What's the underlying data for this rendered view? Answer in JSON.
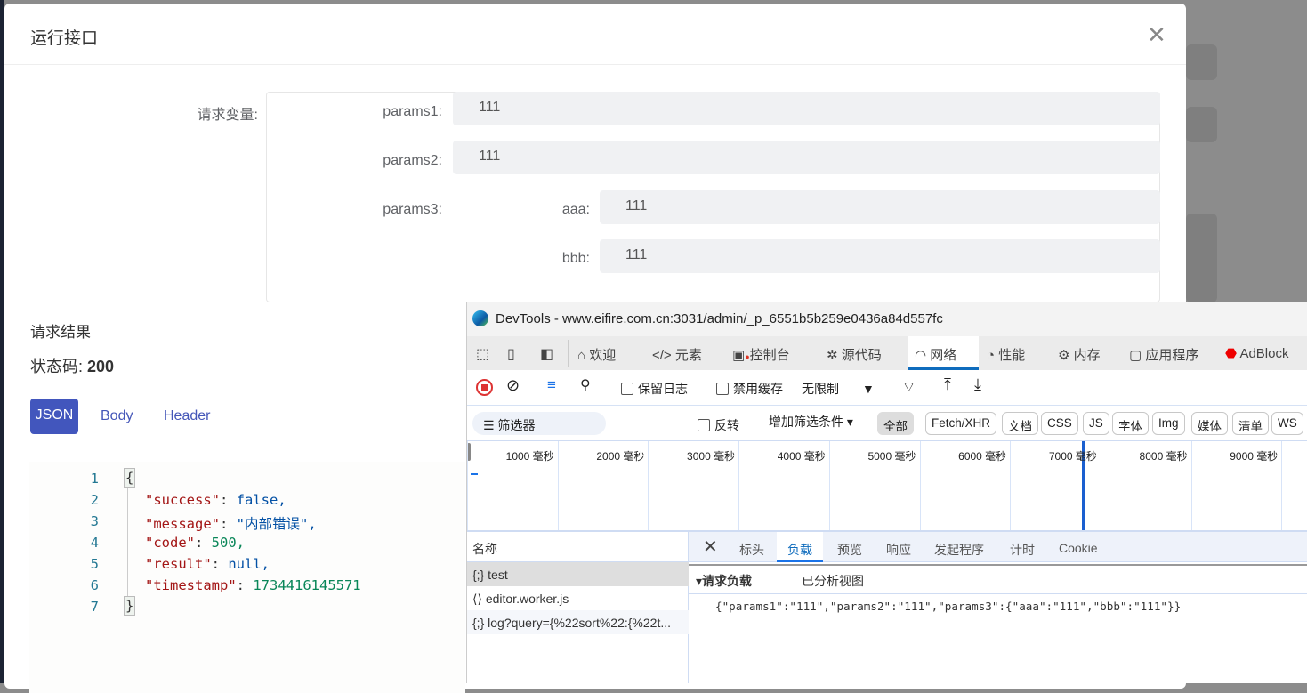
{
  "modal": {
    "title": "运行接口",
    "close_icon": "close-icon",
    "variables_label": "请求变量:",
    "fields": [
      {
        "label": "params1:",
        "value": "111"
      },
      {
        "label": "params2:",
        "value": "111"
      },
      {
        "label": "params3:",
        "children": [
          {
            "label": "aaa:",
            "value": "111"
          },
          {
            "label": "bbb:",
            "value": "111"
          }
        ]
      }
    ],
    "result_title": "请求结果",
    "status_label": "状态码:",
    "status_code": "200",
    "tabs": [
      {
        "label": "JSON",
        "active": true
      },
      {
        "label": "Body"
      },
      {
        "label": "Header"
      }
    ],
    "accent": "#4256bd",
    "code_lines": [
      {
        "n": "1",
        "text": "{"
      },
      {
        "n": "2",
        "key": "\"success\"",
        "value": "false,"
      },
      {
        "n": "3",
        "key": "\"message\"",
        "value": "\"内部错误\","
      },
      {
        "n": "4",
        "key": "\"code\"",
        "value": "500,"
      },
      {
        "n": "5",
        "key": "\"result\"",
        "value": "null,"
      },
      {
        "n": "6",
        "key": "\"timestamp\"",
        "value": "1734416145571"
      },
      {
        "n": "7",
        "text": "}"
      }
    ]
  },
  "devtools": {
    "title": "DevTools - www.eifire.com.cn:3031/admin/_p_6551b5b259e0436a84d557fc",
    "tabs": [
      "欢迎",
      "元素",
      "控制台",
      "源代码",
      "网络",
      "性能",
      "内存",
      "应用程序",
      "AdBlock"
    ],
    "active_tab": "网络",
    "toolbar": {
      "preserve_log": "保留日志",
      "disable_cache": "禁用缓存",
      "throttle": "无限制"
    },
    "filter": {
      "placeholder": "筛选器",
      "invert": "反转",
      "more_filters": "增加筛选条件",
      "types": [
        "全部",
        "Fetch/XHR",
        "文档",
        "CSS",
        "JS",
        "字体",
        "Img",
        "媒体",
        "清单",
        "WS"
      ]
    },
    "timeline_ticks": [
      "1000 毫秒",
      "2000 毫秒",
      "3000 毫秒",
      "4000 毫秒",
      "5000 毫秒",
      "6000 毫秒",
      "7000 毫秒",
      "8000 毫秒",
      "9000 毫秒"
    ],
    "name_header": "名称",
    "requests": [
      "test",
      "editor.worker.js",
      "log?query={%22sort%22:{%22t..."
    ],
    "detail_tabs": [
      "标头",
      "负载",
      "预览",
      "响应",
      "发起程序",
      "计时",
      "Cookie"
    ],
    "active_detail_tab": "负载",
    "payload_title": "请求负载",
    "parsed_view": "已分析视图",
    "payload": "{\"params1\":\"111\",\"params2\":\"111\",\"params3\":{\"aaa\":\"111\",\"bbb\":\"111\"}}"
  }
}
